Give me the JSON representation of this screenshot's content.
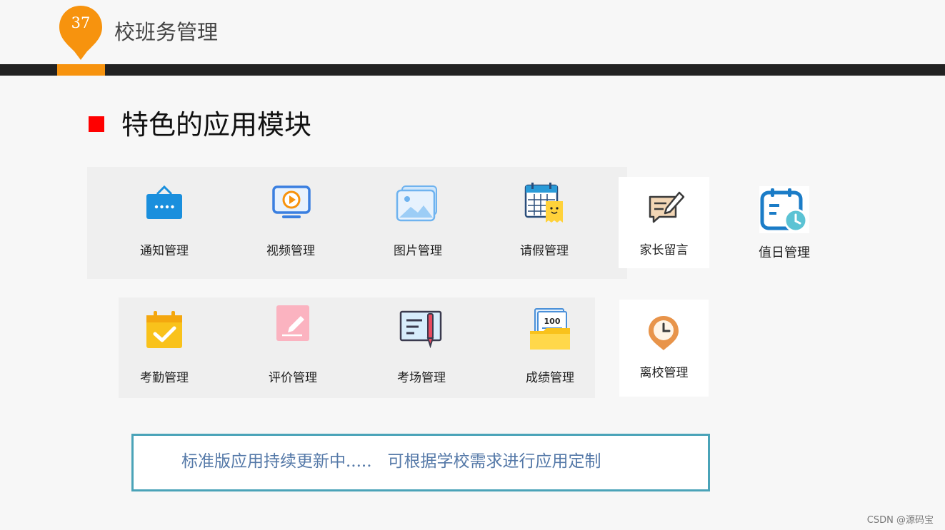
{
  "header": {
    "slide_number": "37",
    "title": "校班务管理"
  },
  "section": {
    "heading": "特色的应用模块"
  },
  "modules_row1": [
    {
      "label": "通知管理",
      "icon": "notice-icon"
    },
    {
      "label": "视频管理",
      "icon": "video-icon"
    },
    {
      "label": "图片管理",
      "icon": "image-icon"
    },
    {
      "label": "请假管理",
      "icon": "leave-calendar-icon"
    }
  ],
  "module_parent_message": {
    "label": "家长留言",
    "icon": "message-edit-icon"
  },
  "module_duty": {
    "label": "值日管理",
    "icon": "duty-calendar-icon"
  },
  "modules_row2": [
    {
      "label": "考勤管理",
      "icon": "attendance-icon"
    },
    {
      "label": "评价管理",
      "icon": "evaluation-icon"
    },
    {
      "label": "考场管理",
      "icon": "exam-room-icon"
    },
    {
      "label": "成绩管理",
      "icon": "score-folder-icon"
    }
  ],
  "module_leave_school": {
    "label": "离校管理",
    "icon": "clock-pin-icon"
  },
  "info": {
    "text": "标准版应用持续更新中.....   可根据学校需求进行应用定制"
  },
  "watermark": "CSDN @源码宝",
  "colors": {
    "accent_orange": "#f7930e",
    "dark_rule": "#222222",
    "bullet_red": "#ff0000",
    "info_border": "#4aa3b8",
    "info_text": "#5579a8"
  }
}
